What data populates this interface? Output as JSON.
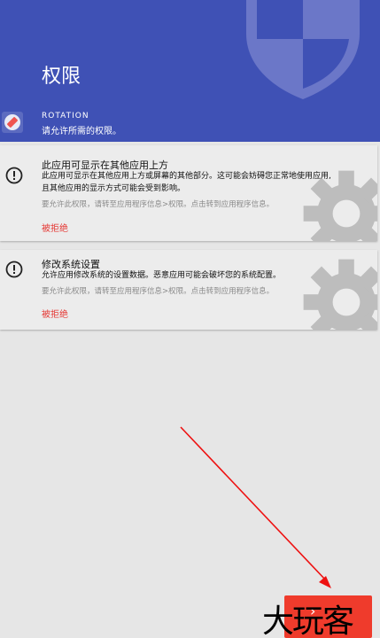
{
  "header": {
    "title": "权限",
    "app_name": "ROTATION",
    "subtitle": "请允许所需的权限。",
    "bg_color": "#3f51b5"
  },
  "permissions": [
    {
      "title": "此应用可显示在其他应用上方",
      "desc_line1": "此应用可显示在其他应用上方或屏幕的其他部分。这可能会妨碍您正常地使用应用,",
      "desc_line2": "且其他应用的显示方式可能会受到影响。",
      "hint": "要允许此权限，请转至应用程序信息>权限。点击转到应用程序信息。",
      "status": "被拒绝",
      "icon": "alert-circle-icon"
    },
    {
      "title": "修改系统设置",
      "desc_line1": "允许应用修改系统的设置数据。恶意应用可能会破坏您的系统配置。",
      "hint": "要允许此权限，请转至应用程序信息>权限。点击转到应用程序信息。",
      "status": "被拒绝",
      "icon": "alert-circle-icon"
    }
  ],
  "footer": {
    "next_button_glyph": "›",
    "watermark": "大玩客",
    "button_color": "#ef3b2c"
  }
}
